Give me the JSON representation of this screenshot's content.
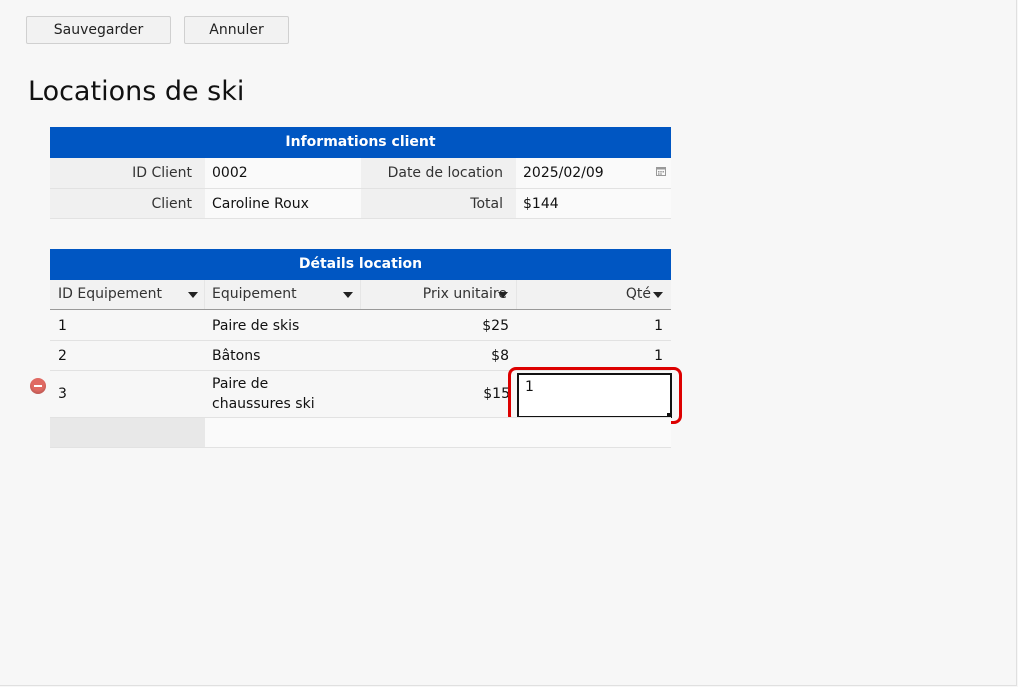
{
  "toolbar": {
    "save_label": "Sauvegarder",
    "cancel_label": "Annuler"
  },
  "page": {
    "title": "Locations de ski"
  },
  "client_info": {
    "header": "Informations client",
    "fields": {
      "client_id_label": "ID Client",
      "client_id_value": "0002",
      "rental_date_label": "Date de location",
      "rental_date_value": "2025/02/09",
      "client_label": "Client",
      "client_value": "Caroline Roux",
      "total_label": "Total",
      "total_value": "$144"
    }
  },
  "rental_details": {
    "header": "Détails location",
    "columns": [
      "ID Equipement",
      "Equipement",
      "Prix unitaire",
      "Qté"
    ],
    "rows": [
      {
        "id": "1",
        "equipment": "Paire de skis",
        "price": "$25",
        "qty": "1"
      },
      {
        "id": "2",
        "equipment": "Bâtons",
        "price": "$8",
        "qty": "1"
      },
      {
        "id": "3",
        "equipment": "Paire de chaussures ski",
        "price": "$15",
        "qty": "1"
      }
    ]
  },
  "icons": {
    "calendar": "calendar-icon",
    "delete": "delete-row-icon",
    "sort": "dropdown-triangle-icon"
  },
  "colors": {
    "header_bg": "#0056c2",
    "highlight": "#dd0000",
    "delete": "#e06a63"
  }
}
